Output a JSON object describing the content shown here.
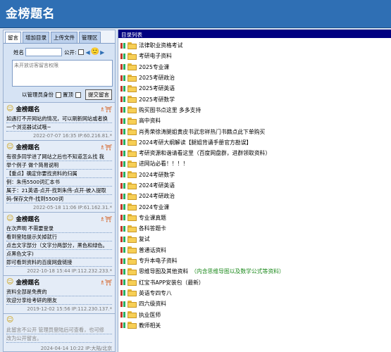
{
  "header": {
    "title": "金榜题名"
  },
  "tabs": [
    {
      "label": "留言",
      "active": true
    },
    {
      "label": "增加目录",
      "active": false
    },
    {
      "label": "上传文件",
      "active": false
    },
    {
      "label": "管理区",
      "active": false
    }
  ],
  "form": {
    "name_label": "姓名",
    "name_value": "",
    "public_label": "公开:",
    "textarea_placeholder": "未开放访客留言权限",
    "admin_label": "以管理员身份",
    "pin_label": "置顶",
    "submit_label": "提交留言"
  },
  "comments": [
    {
      "author": "金榜题名",
      "lines": [
        "如遇打不开网站的情况，可以刷新网站或者换",
        "一个浏览器试试哦~"
      ],
      "meta": "2022-07-07 16:35 IP:60.216.81.*"
    },
    {
      "author": "金榜题名",
      "lines": [
        "有很多同学进了网站之后也不知道怎么找 我",
        "举个例子 做个简易说明",
        "【重点】确定你要找资料的归属",
        "例：朱伟5500词汇本书",
        "属于：21英语-点开-找到朱伟-点开-被入提取",
        "码-保存文件-找到5500词"
      ],
      "meta": "2022-05-18 11:06 IP:61.162.31.*"
    },
    {
      "author": "金榜题名",
      "lines": [
        "在次声明 不需要登录",
        "看到登陆提示关掉就行",
        "点击文字部分（文字分两部分，黑色和绿色。",
        "点黑色文字)",
        "即可看到资料的百度网盘链接"
      ],
      "meta": "2022-10-18 15:44 IP:112.232.233.*"
    },
    {
      "author": "金榜题名",
      "lines": [
        "资料全部是免费的",
        "欢迎分享给考研的朋友"
      ],
      "meta": "2019-12-02 15:56 IP:112.230.137.*"
    },
    {
      "author": "",
      "lines": [
        "此留言不公开 管理员登陆后可查看，也可修",
        "改为公开留言。"
      ],
      "meta": "2024-04-14 10:22 IP:大陆/北京"
    }
  ],
  "directory": {
    "header": "目录列表",
    "items": [
      {
        "label": "法律职业资格考试",
        "note": ""
      },
      {
        "label": "考研电子资料",
        "note": ""
      },
      {
        "label": "2025专业课",
        "note": ""
      },
      {
        "label": "2025考研政治",
        "note": ""
      },
      {
        "label": "2025考研英语",
        "note": ""
      },
      {
        "label": "2025考研数学",
        "note": ""
      },
      {
        "label": "购买图书点这里 多多支持",
        "note": ""
      },
      {
        "label": "高中资料",
        "note": ""
      },
      {
        "label": "肖秀荣徐涛腿姐黄皮书武忠祥热门书籍点此下单购买",
        "note": ""
      },
      {
        "label": "2024考研大纲解读【腿姐背诵手册官方勘误】",
        "note": ""
      },
      {
        "label": "考研资源和谐请看这里（百度网盘群，进群领取资料）",
        "note": ""
      },
      {
        "label": "进网站必看！！！！",
        "note": ""
      },
      {
        "label": "2024考研数学",
        "note": ""
      },
      {
        "label": "2024考研英语",
        "note": ""
      },
      {
        "label": "2024考研政治",
        "note": ""
      },
      {
        "label": "2024专业课",
        "note": ""
      },
      {
        "label": "专业课真题",
        "note": ""
      },
      {
        "label": "各科答题卡",
        "note": ""
      },
      {
        "label": "复试",
        "note": ""
      },
      {
        "label": "普通话资料",
        "note": ""
      },
      {
        "label": "专升本电子资料",
        "note": ""
      },
      {
        "label": "思维导图及其他资料",
        "note": "（内含思维导图以及数学公式等资料）"
      },
      {
        "label": "红宝书APP安装包（最新）",
        "note": ""
      },
      {
        "label": "英语专四专八",
        "note": ""
      },
      {
        "label": "四六级资料",
        "note": ""
      },
      {
        "label": "执业医师",
        "note": ""
      },
      {
        "label": "教师相关",
        "note": ""
      }
    ]
  }
}
